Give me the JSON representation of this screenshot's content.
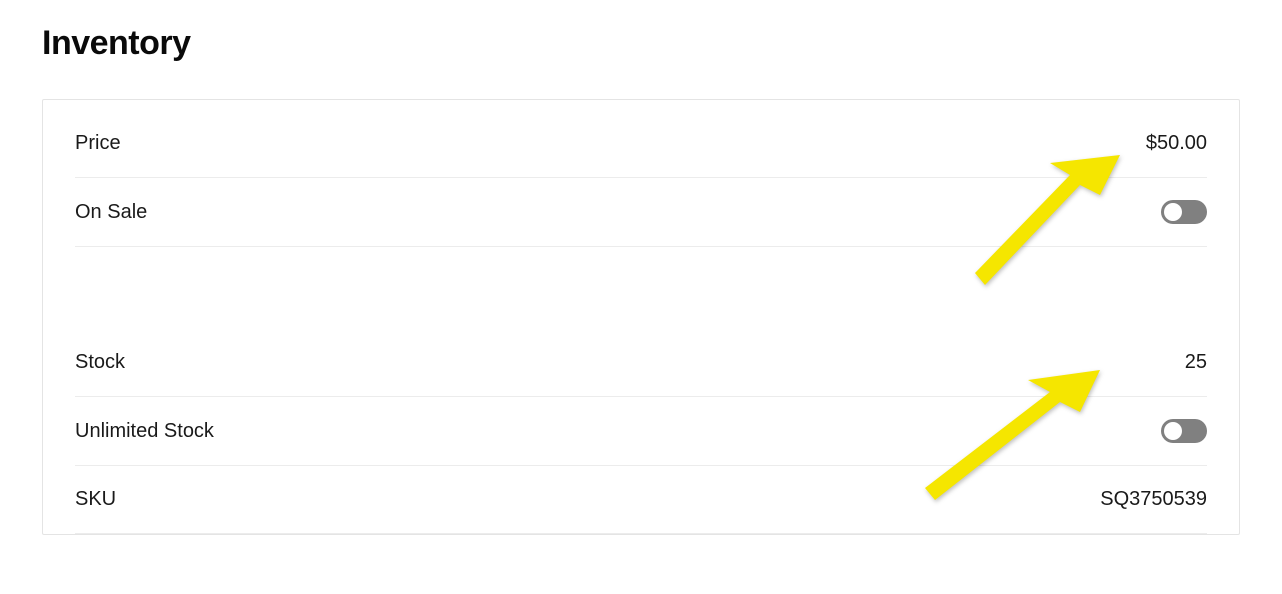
{
  "section_title": "Inventory",
  "rows": {
    "price": {
      "label": "Price",
      "value": "$50.00"
    },
    "on_sale": {
      "label": "On Sale",
      "toggle": false
    },
    "stock": {
      "label": "Stock",
      "value": "25"
    },
    "unlimited_stock": {
      "label": "Unlimited Stock",
      "toggle": false
    },
    "sku": {
      "label": "SKU",
      "value": "SQ3750539"
    }
  }
}
